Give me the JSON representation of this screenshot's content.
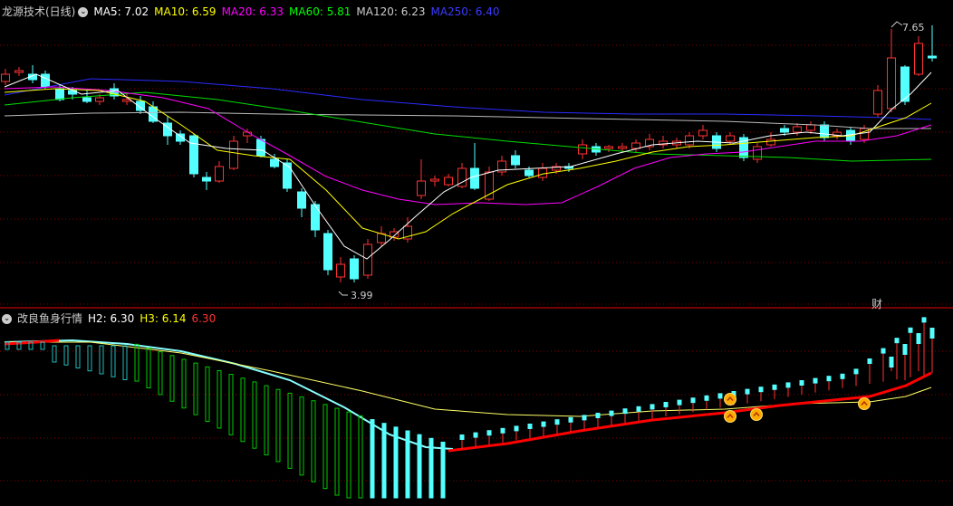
{
  "main_panel": {
    "title": "龙源技术(日线)",
    "ma": [
      {
        "label": "MA5: 7.02",
        "color": "#ffffff"
      },
      {
        "label": "MA10: 6.59",
        "color": "#ffff00"
      },
      {
        "label": "MA20: 6.33",
        "color": "#ff00ff"
      },
      {
        "label": "MA60: 5.81",
        "color": "#00ff00"
      },
      {
        "label": "MA120: 6.23",
        "color": "#cccccc"
      },
      {
        "label": "MA250: 6.40",
        "color": "#0000ff"
      }
    ],
    "high_label": "7.65",
    "low_label": "3.99",
    "cai_marker": "财"
  },
  "sub_panel": {
    "title": "改良鱼身行情",
    "h2": "H2: 6.30",
    "h3": "H3: 6.14",
    "extra": "6.30"
  },
  "colors": {
    "up": "#ff3232",
    "down": "#54ffff",
    "grid": "#800000",
    "divider": "#a00000"
  }
}
